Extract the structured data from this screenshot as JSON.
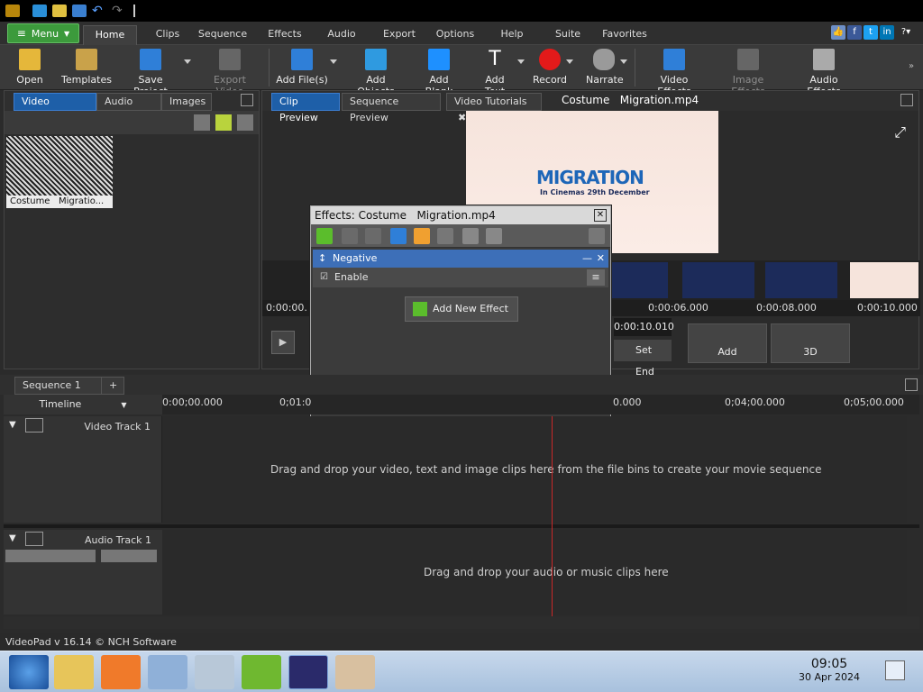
{
  "app": {
    "name": "VideoPad",
    "version_text": "VideoPad v 16.14 © NCH Software"
  },
  "menu_button": {
    "label": "Menu"
  },
  "tabs": [
    {
      "label": "Home",
      "active": true
    },
    {
      "label": "Clips"
    },
    {
      "label": "Sequence"
    },
    {
      "label": "Effects"
    },
    {
      "label": "Audio"
    },
    {
      "label": "Export"
    },
    {
      "label": "Options"
    },
    {
      "label": "Help"
    },
    {
      "label": "Suite"
    },
    {
      "label": "Favorites"
    }
  ],
  "toolbar": [
    {
      "label": "Open",
      "icon": "folder-icon"
    },
    {
      "label": "Templates",
      "icon": "templates-icon"
    },
    {
      "label": "Save Project",
      "icon": "save-icon"
    },
    {
      "label": "Export Video",
      "icon": "export-video-icon",
      "disabled": true
    },
    {
      "label": "Add File(s)",
      "icon": "add-files-icon"
    },
    {
      "label": "Add Objects",
      "icon": "add-objects-icon"
    },
    {
      "label": "Add Blank",
      "icon": "add-blank-icon"
    },
    {
      "label": "Add Text",
      "icon": "add-text-icon"
    },
    {
      "label": "Record",
      "icon": "record-icon"
    },
    {
      "label": "Narrate",
      "icon": "microphone-icon"
    },
    {
      "label": "Video Effects",
      "icon": "video-effects-icon"
    },
    {
      "label": "Image Effects",
      "icon": "image-effects-icon",
      "disabled": true
    },
    {
      "label": "Audio Effects",
      "icon": "audio-effects-icon"
    }
  ],
  "bins": {
    "tabs": [
      {
        "label": "Video Files",
        "active": true
      },
      {
        "label": "Audio Files"
      },
      {
        "label": "Images"
      }
    ],
    "item": {
      "label": "Costume   Migratio..."
    }
  },
  "preview": {
    "tabs": [
      {
        "label": "Clip Preview",
        "active": true
      },
      {
        "label": "Sequence Preview"
      },
      {
        "label": "Video Tutorials"
      }
    ],
    "clip_title": "Costume   Migration.mp4",
    "poster_title": "MIGRATION",
    "poster_sub": "In Cinemas 29th December",
    "ruler": [
      "0:00:00.",
      "0:00:06.000",
      "0:00:08.000",
      "0:00:10.000"
    ],
    "time_end": "0:00:10.010",
    "set_end": "Set End",
    "add_label": "Add",
    "three_d_label": "3D"
  },
  "effects_dialog": {
    "title": "Effects: Costume   Migration.mp4",
    "effect_name": "Negative",
    "enable_label": "Enable",
    "add_new_label": "Add New Effect"
  },
  "sequence": {
    "tab_label": "Sequence 1",
    "timeline_label": "Timeline",
    "ruler": [
      "0:00;00.000",
      "0;01:0",
      "0.000",
      "0;04;00.000",
      "0;05;00.000"
    ],
    "video_track": "Video Track 1",
    "audio_track": "Audio Track 1",
    "video_hint": "Drag and drop your video, text and image clips here from the file bins to create your movie sequence",
    "audio_hint": "Drag and drop your audio or music clips here"
  },
  "taskbar": {
    "time": "09:05",
    "date": "30 Apr 2024"
  }
}
